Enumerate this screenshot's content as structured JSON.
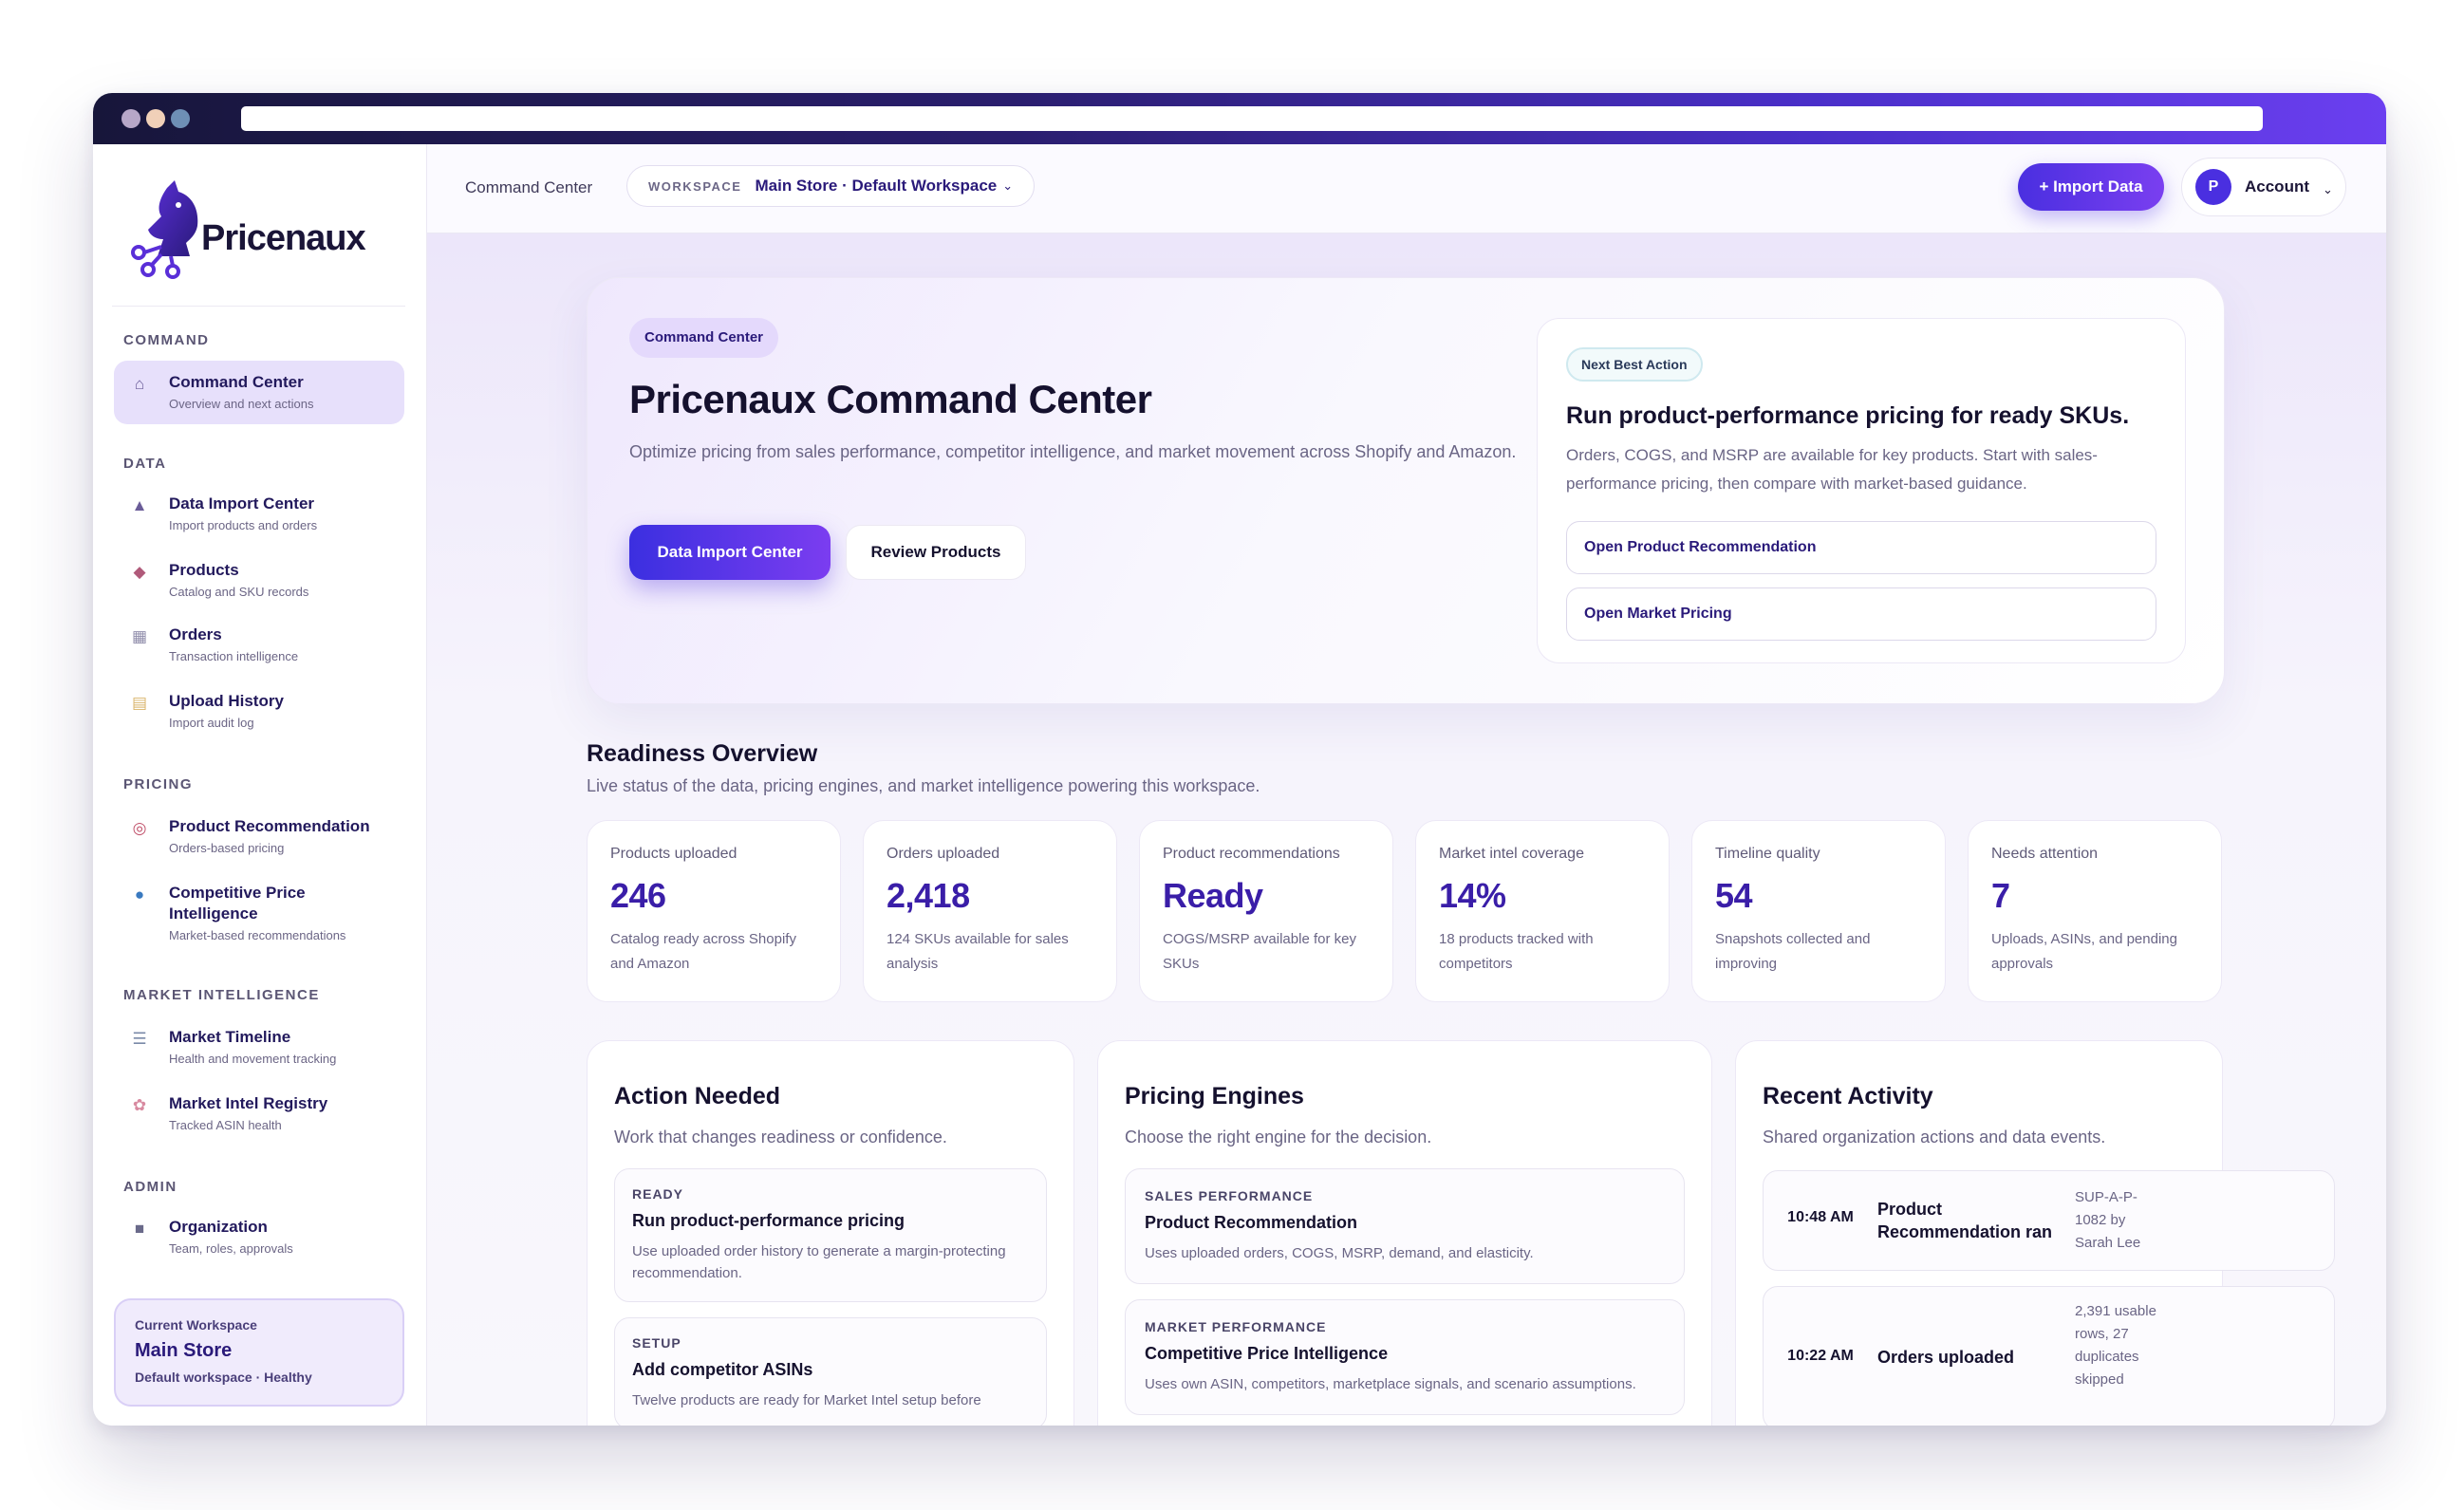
{
  "brand": {
    "name": "Pricenaux"
  },
  "sidebar": {
    "sections": [
      {
        "label": "COMMAND"
      },
      {
        "label": "DATA"
      },
      {
        "label": "PRICING"
      },
      {
        "label": "MARKET INTELLIGENCE"
      },
      {
        "label": "ADMIN"
      }
    ],
    "items": [
      {
        "title": "Command Center",
        "sub": "Overview and next actions",
        "icon": "home-icon"
      },
      {
        "title": "Data Import Center",
        "sub": "Import products and orders",
        "icon": "upload-icon"
      },
      {
        "title": "Products",
        "sub": "Catalog and SKU records",
        "icon": "box-icon"
      },
      {
        "title": "Orders",
        "sub": "Transaction intelligence",
        "icon": "receipt-icon"
      },
      {
        "title": "Upload History",
        "sub": "Import audit log",
        "icon": "scroll-icon"
      },
      {
        "title": "Product Recommendation",
        "sub": "Orders-based pricing",
        "icon": "target-icon"
      },
      {
        "title": "Competitive Price Intelligence",
        "sub": "Market-based recommendations",
        "icon": "globe-icon"
      },
      {
        "title": "Market Timeline",
        "sub": "Health and movement tracking",
        "icon": "chart-icon"
      },
      {
        "title": "Market Intel Registry",
        "sub": "Tracked ASIN health",
        "icon": "brain-icon"
      },
      {
        "title": "Organization",
        "sub": "Team, roles, approvals",
        "icon": "building-icon"
      }
    ],
    "workspace": {
      "label": "Current Workspace",
      "name": "Main Store",
      "status": "Default workspace · Healthy"
    }
  },
  "header": {
    "crumb": "Command Center",
    "workspace_label": "WORKSPACE",
    "workspace_value": "Main Store · Default Workspace",
    "import_label": "+ Import Data",
    "account_initial": "P",
    "account_label": "Account"
  },
  "hero": {
    "tag": "Command Center",
    "title": "Pricenaux Command Center",
    "desc": "Optimize pricing from sales performance, competitor intelligence, and market movement across Shopify and Amazon.",
    "primary": "Data Import Center",
    "secondary": "Review Products",
    "nba": {
      "tag": "Next Best Action",
      "title": "Run product-performance pricing for ready SKUs.",
      "desc": "Orders, COGS, and MSRP are available for key products. Start with sales-performance pricing, then compare with market-based guidance.",
      "link1": "Open Product Recommendation",
      "link2": "Open Market Pricing"
    }
  },
  "readiness": {
    "title": "Readiness Overview",
    "sub": "Live status of the data, pricing engines, and market intelligence powering this workspace.",
    "stats": [
      {
        "label": "Products uploaded",
        "value": "246",
        "desc": "Catalog ready across Shopify and Amazon"
      },
      {
        "label": "Orders uploaded",
        "value": "2,418",
        "desc": "124 SKUs available for sales analysis"
      },
      {
        "label": "Product recommendations",
        "value": "Ready",
        "desc": "COGS/MSRP available for key SKUs"
      },
      {
        "label": "Market intel coverage",
        "value": "14%",
        "desc": "18 products tracked with competitors"
      },
      {
        "label": "Timeline quality",
        "value": "54",
        "desc": "Snapshots collected and improving"
      },
      {
        "label": "Needs attention",
        "value": "7",
        "desc": "Uploads, ASINs, and pending approvals"
      }
    ]
  },
  "action": {
    "title": "Action Needed",
    "sub": "Work that changes readiness or confidence.",
    "tasks": [
      {
        "kind": "READY",
        "title": "Run product-performance pricing",
        "desc": "Use uploaded order history to generate a margin-protecting recommendation."
      },
      {
        "kind": "SETUP",
        "title": "Add competitor ASINs",
        "desc": "Twelve products are ready for Market Intel setup before"
      }
    ]
  },
  "engines": {
    "title": "Pricing Engines",
    "sub": "Choose the right engine for the decision.",
    "items": [
      {
        "kind": "SALES PERFORMANCE",
        "title": "Product Recommendation",
        "desc": "Uses uploaded orders, COGS, MSRP, demand, and elasticity."
      },
      {
        "kind": "MARKET PERFORMANCE",
        "title": "Competitive Price Intelligence",
        "desc": "Uses own ASIN, competitors, marketplace signals, and scenario assumptions."
      }
    ]
  },
  "activity": {
    "title": "Recent Activity",
    "sub": "Shared organization actions and data events.",
    "rows": [
      {
        "time": "10:48 AM",
        "name": "Product Recommendation ran",
        "detail": "SUP-A-P-1082 by Sarah Lee"
      },
      {
        "time": "10:22 AM",
        "name": "Orders uploaded",
        "detail": "2,391 usable rows, 27 duplicates skipped"
      }
    ]
  },
  "colors": {
    "accent": "#4a2fe0",
    "accent2": "#7b3df0",
    "ink": "#15112e"
  }
}
